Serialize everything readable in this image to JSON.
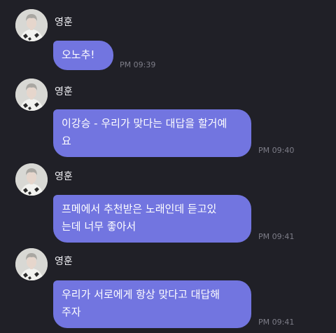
{
  "messages": [
    {
      "sender": "영훈",
      "avatar": "profile-photo",
      "lines": [
        "오노추!"
      ],
      "time": "PM 09:39"
    },
    {
      "sender": "영훈",
      "avatar": "profile-photo",
      "lines": [
        "이강승 - 우리가 맞다는 대답을 할거예",
        "요"
      ],
      "time": "PM 09:40"
    },
    {
      "sender": "영훈",
      "avatar": "profile-photo",
      "lines": [
        "프메에서 추천받은 노래인데 듣고있",
        "는데 너무 좋아서"
      ],
      "time": "PM 09:41"
    },
    {
      "sender": "영훈",
      "avatar": "profile-photo",
      "lines": [
        "우리가 서로에게 항상 맞다고 대답해",
        "주자"
      ],
      "time": "PM 09:41"
    }
  ],
  "colors": {
    "background": "#202027",
    "bubble": "#7275e0",
    "bubble_text": "#ffffff",
    "sender_text": "#eeeef2",
    "timestamp": "#7d7d88"
  }
}
